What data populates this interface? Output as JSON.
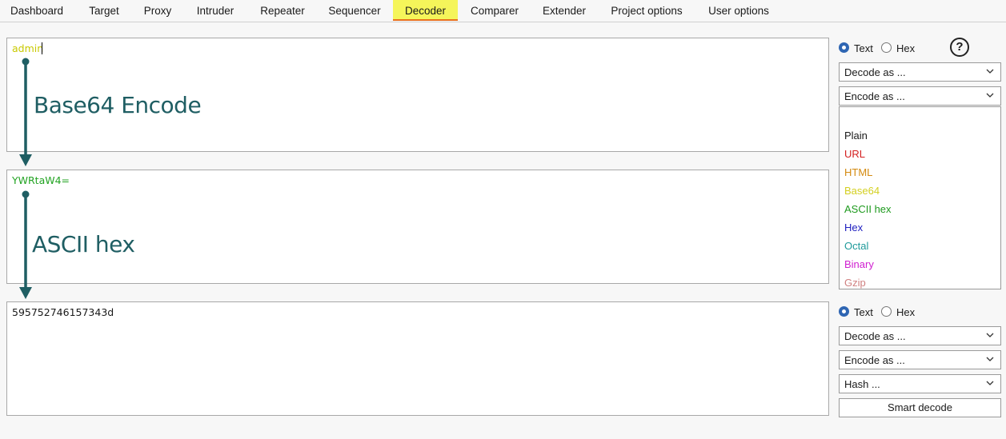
{
  "tabs": [
    "Dashboard",
    "Target",
    "Proxy",
    "Intruder",
    "Repeater",
    "Sequencer",
    "Decoder",
    "Comparer",
    "Extender",
    "Project options",
    "User options"
  ],
  "active_tab": "Decoder",
  "panes": [
    {
      "text": "admin",
      "color": "#c9c900"
    },
    {
      "text": "YWRtaW4=",
      "color": "#22a322"
    },
    {
      "text": "595752746157343d",
      "color": "#1a1a1a"
    }
  ],
  "annotations": {
    "first": "Base64 Encode",
    "second": "ASCII hex",
    "color": "#1f5e63"
  },
  "controls": {
    "text_label": "Text",
    "hex_label": "Hex",
    "help": "?",
    "decode_as": "Decode as ...",
    "encode_as": "Encode as ...",
    "hash": "Hash ...",
    "smart_decode": "Smart decode"
  },
  "dropdown_options": [
    {
      "label": "Plain",
      "color": "#1a1a1a"
    },
    {
      "label": "URL",
      "color": "#d42020"
    },
    {
      "label": "HTML",
      "color": "#d48a10"
    },
    {
      "label": "Base64",
      "color": "#d4d020"
    },
    {
      "label": "ASCII hex",
      "color": "#1e9a1e"
    },
    {
      "label": "Hex",
      "color": "#2020c0"
    },
    {
      "label": "Octal",
      "color": "#1e9a9a"
    },
    {
      "label": "Binary",
      "color": "#d020d0"
    },
    {
      "label": "Gzip",
      "color": "#d08080"
    }
  ]
}
